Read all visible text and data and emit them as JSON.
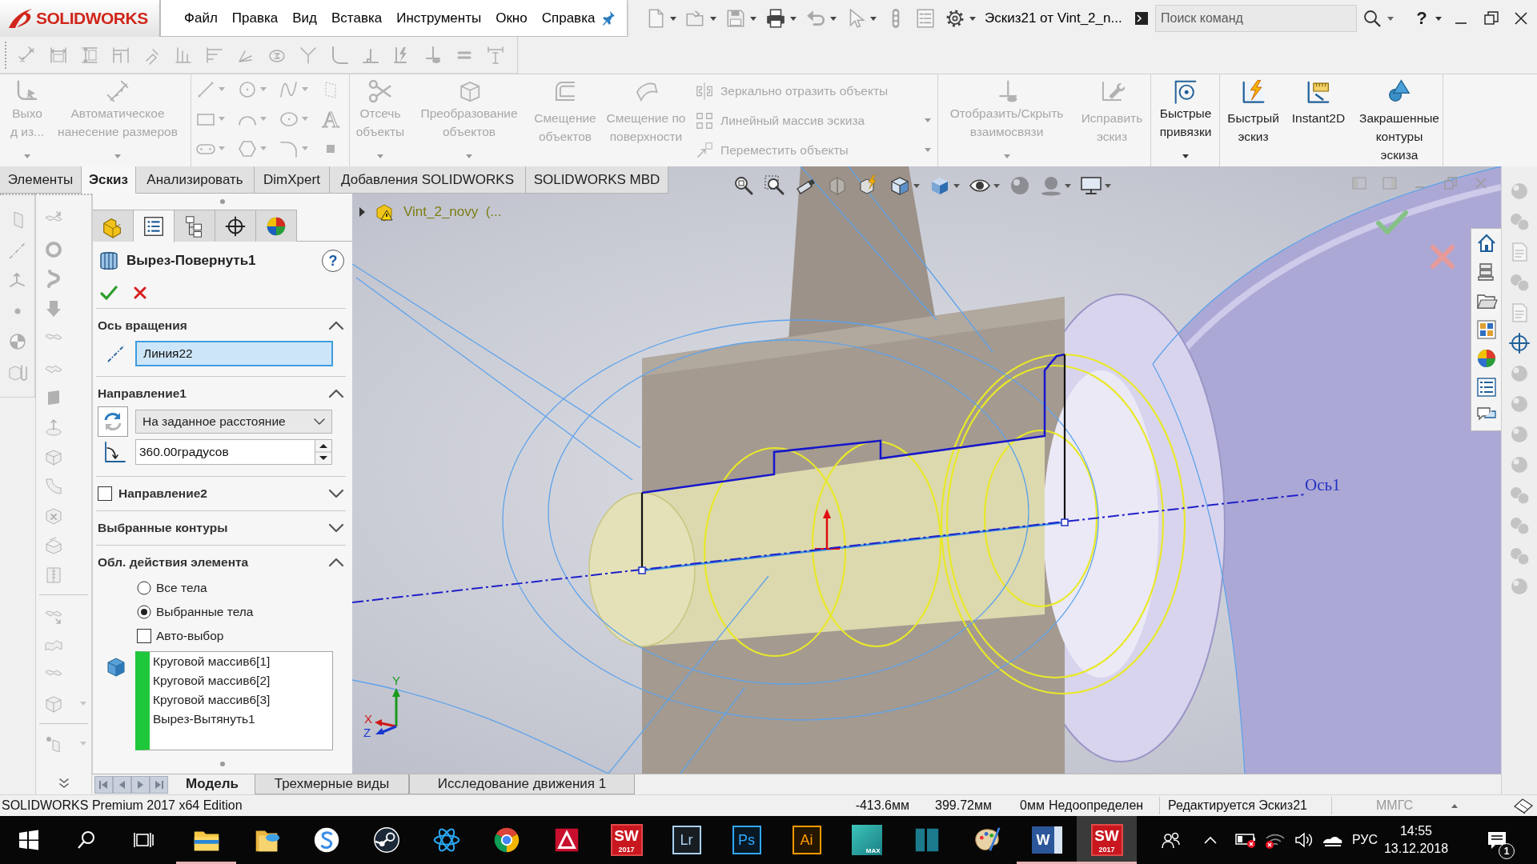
{
  "title_bar": {
    "logo": "**SOLID**WORKS",
    "menu": [
      "Файл",
      "Правка",
      "Вид",
      "Вставка",
      "Инструменты",
      "Окно",
      "Справка"
    ],
    "quick_access": [
      {
        "kind": "new",
        "disabled": true,
        "dropdown": true
      },
      {
        "kind": "open",
        "disabled": true,
        "dropdown": true
      },
      {
        "kind": "save",
        "disabled": true,
        "dropdown": true
      },
      {
        "kind": "print",
        "disabled": false,
        "dropdown": true
      },
      {
        "kind": "undo",
        "disabled": true,
        "dropdown": true
      },
      {
        "kind": "select",
        "disabled": true,
        "dropdown": true
      },
      {
        "kind": "rebuild",
        "disabled": true,
        "dropdown": false
      },
      {
        "kind": "properties",
        "disabled": true,
        "dropdown": false
      },
      {
        "kind": "options",
        "disabled": false,
        "dropdown": true
      }
    ],
    "document_title": "Эскиз21 от Vint_2_n...",
    "search": {
      "placeholder": "Поиск команд"
    },
    "help": "?"
  },
  "sketch_toolbar": {
    "disabled": true
  },
  "command_manager": {
    "groups": [
      [
        {
          "kind": "large",
          "label": "Выход из...",
          "disabled": true,
          "dropdown": true
        },
        {
          "kind": "large",
          "label": "Автоматическое нанесение размеров",
          "disabled": true,
          "dropdown": true
        }
      ],
      [
        {
          "kind": "entities",
          "disabled": true,
          "text_tool": "A"
        }
      ],
      [
        {
          "kind": "large",
          "label": "Отсечь объекты",
          "disabled": true,
          "dropdown": true
        },
        {
          "kind": "large",
          "label": "Преобразование объектов",
          "disabled": true,
          "dropdown": true
        },
        {
          "kind": "large",
          "label": "Смещение объектов",
          "disabled": true,
          "dropdown": false
        },
        {
          "kind": "large",
          "label": "Смещение по поверхности",
          "disabled": true,
          "dropdown": false
        },
        {
          "kind": "stack",
          "rows": [
            {
              "label": "Зеркально отразить объекты",
              "disabled": true,
              "dropdown": false
            },
            {
              "label": "Линейный массив эскиза",
              "disabled": true,
              "dropdown": true
            },
            {
              "label": "Переместить объекты",
              "disabled": true,
              "dropdown": true
            }
          ]
        }
      ],
      [
        {
          "kind": "large",
          "label": "Отобразить/Скрыть взаимосвязи",
          "disabled": true,
          "dropdown": true
        },
        {
          "kind": "large",
          "label": "Исправить эскиз",
          "disabled": true,
          "dropdown": false
        }
      ],
      [
        {
          "kind": "large",
          "label": "Быстрые привязки",
          "disabled": false,
          "dropdown": true
        }
      ],
      [
        {
          "kind": "large",
          "label": "Быстрый эскиз",
          "disabled": false,
          "dropdown": false
        },
        {
          "kind": "large",
          "label": "Instant2D",
          "disabled": false,
          "dropdown": false
        },
        {
          "kind": "large",
          "label": "Закрашенные контуры эскиза",
          "disabled": false,
          "dropdown": false
        }
      ]
    ]
  },
  "tabs": [
    {
      "label": "Элементы",
      "selected": false
    },
    {
      "label": "Эскиз",
      "selected": true
    },
    {
      "label": "Анализировать",
      "selected": false
    },
    {
      "label": "DimXpert",
      "selected": false
    },
    {
      "label": "Добавления SOLIDWORKS",
      "selected": false
    },
    {
      "label": "SOLIDWORKS MBD",
      "selected": false
    }
  ],
  "side_toolbars": {
    "disabled": true
  },
  "property_manager": {
    "tabs": [
      {
        "kind": "features",
        "selected": false
      },
      {
        "kind": "properties",
        "selected": true
      },
      {
        "kind": "configurations",
        "selected": false
      },
      {
        "kind": "dimxpert",
        "selected": false
      },
      {
        "kind": "display",
        "selected": false
      }
    ],
    "title": "Вырез-Повернуть1",
    "help": "?",
    "sections": [
      {
        "kind": "axis",
        "title": "Ось вращения",
        "expanded": true,
        "value": "Линия22",
        "active": true
      },
      {
        "kind": "direction",
        "title": "Направление1",
        "expanded": true,
        "end_condition": "На заданное расстояние",
        "angle": "360.00градусов"
      },
      {
        "kind": "optional_direction",
        "title": "Направление2",
        "expanded": false,
        "checked": false
      },
      {
        "kind": "contours",
        "title": "Выбранные контуры",
        "expanded": false
      },
      {
        "kind": "scope",
        "title": "Обл. действия элемента",
        "expanded": true,
        "options": [
          {
            "label": "Все тела",
            "selected": false
          },
          {
            "label": "Выбранные тела",
            "selected": true
          }
        ],
        "auto_select": {
          "label": "Авто-выбор",
          "checked": false
        },
        "bodies": [
          "Круговой массив6[1]",
          "Круговой массив6[2]",
          "Круговой массив6[3]",
          "Вырез-Вытянуть1"
        ]
      }
    ]
  },
  "graphics": {
    "tree_flyout": {
      "label": "Vint_2_novy  (...",
      "expanded": false
    },
    "view_toolbar": [
      {
        "kind": "zoomfit",
        "disabled": false,
        "dropdown": false
      },
      {
        "kind": "zoomarea",
        "disabled": false,
        "dropdown": false
      },
      {
        "kind": "previous",
        "disabled": false,
        "dropdown": false
      },
      {
        "kind": "section",
        "disabled": true,
        "dropdown": false
      },
      {
        "kind": "dynamic",
        "disabled": false,
        "dropdown": false
      },
      {
        "kind": "orientation",
        "disabled": false,
        "dropdown": true
      },
      {
        "kind": "display",
        "disabled": false,
        "dropdown": true
      },
      {
        "kind": "hideshow",
        "disabled": false,
        "dropdown": true
      },
      {
        "kind": "appearance",
        "disabled": true,
        "dropdown": false
      },
      {
        "kind": "scene",
        "disabled": true,
        "dropdown": true
      },
      {
        "kind": "settings",
        "disabled": false,
        "dropdown": true
      }
    ],
    "axis_label": "Ось1",
    "triad": {
      "x": "X",
      "y": "Y",
      "z": "Z"
    }
  },
  "right_toolbar": [
    {
      "kind": "sphere",
      "disabled": true
    },
    {
      "kind": "spheres",
      "disabled": true
    },
    {
      "kind": "sheet",
      "disabled": true
    },
    {
      "kind": "spheres",
      "disabled": true
    },
    {
      "kind": "sheet",
      "disabled": true
    },
    {
      "kind": "target",
      "disabled": false
    },
    {
      "kind": "sphere",
      "disabled": true
    },
    {
      "kind": "sphere",
      "disabled": true
    },
    {
      "kind": "sphere",
      "disabled": true
    },
    {
      "kind": "sphere",
      "disabled": true
    },
    {
      "kind": "spheres",
      "disabled": true
    },
    {
      "kind": "spheres",
      "disabled": true
    },
    {
      "kind": "spheres",
      "disabled": true
    },
    {
      "kind": "sphere",
      "disabled": true
    }
  ],
  "bottom_tabs": [
    {
      "label": "Модель",
      "selected": true
    },
    {
      "label": "Трехмерные виды",
      "selected": false
    },
    {
      "label": "Исследование движения 1",
      "selected": false
    }
  ],
  "status_bar": {
    "edition": "SOLIDWORKS Premium 2017 x64 Edition",
    "coordinates": [
      "-413.6мм",
      "399.72мм",
      "0мм"
    ],
    "definition": "Недоопределен",
    "mode": "Редактируется Эскиз21",
    "units": {
      "label": "ММГС",
      "disabled": true
    }
  },
  "taskbar": {
    "apps": [
      {
        "kind": "folder",
        "running": true,
        "selected": false
      },
      {
        "kind": "cloudfolder",
        "running": false,
        "selected": false
      },
      {
        "kind": "scircle",
        "running": false,
        "selected": false
      },
      {
        "kind": "valve",
        "running": false,
        "selected": false
      },
      {
        "kind": "atom",
        "running": false,
        "selected": false
      },
      {
        "kind": "browser",
        "running": false,
        "selected": false
      },
      {
        "kind": "triangle",
        "running": false,
        "selected": false
      },
      {
        "kind": "swtile",
        "label": "SW",
        "version": "2017",
        "running": false,
        "selected": false
      },
      {
        "kind": "tile",
        "label": "Lr",
        "color": "#a9d1f0",
        "running": false,
        "selected": false
      },
      {
        "kind": "tile",
        "label": "Ps",
        "color": "#31a8ff",
        "running": false,
        "selected": false
      },
      {
        "kind": "tile",
        "label": "Ai",
        "color": "#ff9a00",
        "running": false,
        "selected": false
      },
      {
        "kind": "maxtile",
        "label": "MAX",
        "running": false,
        "selected": false
      },
      {
        "kind": "panels",
        "running": false,
        "selected": false
      },
      {
        "kind": "palette",
        "running": false,
        "selected": false
      },
      {
        "kind": "doctile",
        "label": "W",
        "running": true,
        "selected": false
      },
      {
        "kind": "swtile",
        "label": "SW",
        "version": "2017",
        "running": true,
        "selected": true
      }
    ],
    "language": "РУС",
    "time": "14:55",
    "date": "13.12.2018",
    "notifications": "1"
  }
}
